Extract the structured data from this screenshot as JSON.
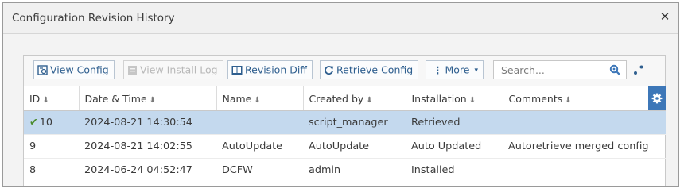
{
  "window": {
    "title": "Configuration Revision History"
  },
  "toolbar": {
    "view_config": "View Config",
    "view_install_log": "View Install Log",
    "revision_diff": "Revision Diff",
    "retrieve_config": "Retrieve Config",
    "more": "More",
    "search_placeholder": "Search..."
  },
  "table": {
    "columns": [
      "ID",
      "Date & Time",
      "Name",
      "Created by",
      "Installation",
      "Comments"
    ],
    "rows": [
      {
        "id": "10",
        "datetime": "2024-08-21 14:30:54",
        "name": "",
        "created_by": "script_manager",
        "installation": "Retrieved",
        "comments": "",
        "selected": true,
        "current": true
      },
      {
        "id": "9",
        "datetime": "2024-08-21 14:02:55",
        "name": "AutoUpdate",
        "created_by": "AutoUpdate",
        "installation": "Auto Updated",
        "comments": "Autoretrieve merged config",
        "selected": false,
        "current": false
      },
      {
        "id": "8",
        "datetime": "2024-06-24 04:52:47",
        "name": "DCFW",
        "created_by": "admin",
        "installation": "Installed",
        "comments": "",
        "selected": false,
        "current": false
      }
    ]
  },
  "colors": {
    "accent": "#3d77b8",
    "selected_row": "#c4d9ee",
    "check": "#4a8b2c"
  }
}
